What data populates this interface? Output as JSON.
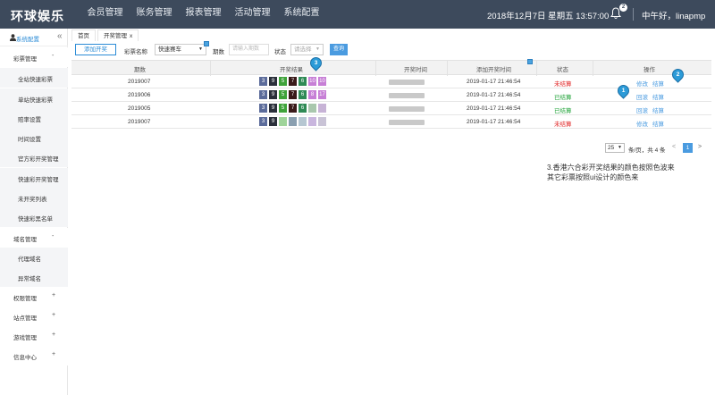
{
  "header": {
    "logo": "环球娱乐",
    "nav": [
      "会员管理",
      "账务管理",
      "报表管理",
      "活动管理",
      "系统配置"
    ],
    "datetime": "2018年12月7日 星期五 13:57:00",
    "notifications": "2",
    "greeting": "中午好，linapmp"
  },
  "sidebar": {
    "header_label": "系统配置",
    "collapse_icon": "«",
    "items": [
      {
        "label": "彩票管理",
        "type": "group",
        "sign": "-"
      },
      {
        "label": "全站快速彩票",
        "type": "sub"
      },
      {
        "label": "单站快速彩票",
        "type": "sub"
      },
      {
        "label": "赔率设置",
        "type": "sub"
      },
      {
        "label": "时间设置",
        "type": "sub"
      },
      {
        "label": "官方彩开奖管理",
        "type": "sub"
      },
      {
        "label": "快速彩开奖管理",
        "type": "sub"
      },
      {
        "label": "未开奖列表",
        "type": "sub"
      },
      {
        "label": "快速彩黑名单",
        "type": "sub"
      },
      {
        "label": "域名管理",
        "type": "group",
        "sign": "-"
      },
      {
        "label": "代理域名",
        "type": "sub"
      },
      {
        "label": "异常域名",
        "type": "sub"
      },
      {
        "label": "权限管理",
        "type": "group",
        "sign": "+"
      },
      {
        "label": "站点管理",
        "type": "group",
        "sign": "+"
      },
      {
        "label": "游戏管理",
        "type": "group",
        "sign": "+"
      },
      {
        "label": "信息中心",
        "type": "group",
        "sign": "+"
      }
    ]
  },
  "tabs": [
    {
      "label": "首页"
    },
    {
      "label": "开奖管理",
      "close": "x"
    }
  ],
  "filters": {
    "add_button": "添加开奖",
    "lottery_label": "彩票名称",
    "lottery_value": "快速赛车",
    "period_label": "期数",
    "period_placeholder": "请输入期数",
    "status_label": "状态",
    "status_value": "请选择",
    "query_button": "查询"
  },
  "table": {
    "columns": [
      "期数",
      "开奖结果",
      "开奖时间",
      "添加开奖时间",
      "状态",
      "操作"
    ],
    "rows": [
      {
        "period": "2019007",
        "balls": [
          {
            "n": "3",
            "c": "#5b6b9a"
          },
          {
            "n": "9",
            "c": "#2a2f3a"
          },
          {
            "n": "5",
            "c": "#3fa33a"
          },
          {
            "n": "7",
            "c": "#3a1a1a"
          },
          {
            "n": "6",
            "c": "#2f8a55"
          },
          {
            "n": "10",
            "c": "#c77fd6"
          },
          {
            "n": "10",
            "c": "#c77fd6"
          }
        ],
        "added": "2019-01-17 21:46:54",
        "status": "未结算",
        "status_kind": "open",
        "ops": [
          "修改",
          "结算"
        ]
      },
      {
        "period": "2019006",
        "balls": [
          {
            "n": "3",
            "c": "#5b6b9a"
          },
          {
            "n": "9",
            "c": "#2a2f3a"
          },
          {
            "n": "5",
            "c": "#3fa33a"
          },
          {
            "n": "7",
            "c": "#3a1a1a"
          },
          {
            "n": "6",
            "c": "#2f8a55"
          },
          {
            "n": "8",
            "c": "#c77fd6"
          },
          {
            "n": "17",
            "c": "#c77fd6"
          }
        ],
        "added": "2019-01-17 21:46:54",
        "status": "已结算",
        "status_kind": "done",
        "ops": [
          "回滚",
          "结算"
        ]
      },
      {
        "period": "2019005",
        "balls": [
          {
            "n": "3",
            "c": "#5b6b9a"
          },
          {
            "n": "9",
            "c": "#2a2f3a"
          },
          {
            "n": "5",
            "c": "#3fa33a"
          },
          {
            "n": "7",
            "c": "#3a1a1a"
          },
          {
            "n": "6",
            "c": "#2f8a55"
          },
          {
            "n": "",
            "c": "#a9c7ad"
          },
          {
            "n": "",
            "c": "#c7b3d6"
          }
        ],
        "added": "2019-01-17 21:46:54",
        "status": "已结算",
        "status_kind": "done",
        "ops": [
          "回滚",
          "结算"
        ]
      },
      {
        "period": "2019007",
        "balls": [
          {
            "n": "3",
            "c": "#5b6b9a"
          },
          {
            "n": "9",
            "c": "#2a2f3a"
          },
          {
            "n": "",
            "c": "#9fd49a"
          },
          {
            "n": "",
            "c": "#8a9fb0"
          },
          {
            "n": "",
            "c": "#b6c7d2"
          },
          {
            "n": "",
            "c": "#c9b6de"
          },
          {
            "n": "",
            "c": "#c9c3d6"
          }
        ],
        "added": "2019-01-17 21:46:54",
        "status": "未结算",
        "status_kind": "open",
        "ops": [
          "修改",
          "结算"
        ]
      }
    ]
  },
  "pagination": {
    "page_size": "25",
    "summary": "条/页，共 4 条",
    "prev": "<",
    "current": "1",
    "next": ">"
  },
  "note": {
    "line1": "3.香港六合彩开奖结果的颜色按照色波来",
    "line2": "其它彩票按照ui设计的颜色来"
  },
  "markers": [
    "1",
    "2",
    "3"
  ],
  "colors": {
    "header_bg": "#3d4a5c",
    "accent": "#4a9be0",
    "open": "#e02020",
    "done": "#1aa033"
  }
}
